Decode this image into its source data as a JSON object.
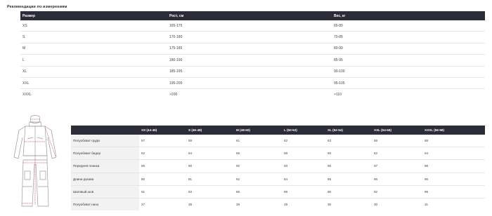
{
  "title": "Рекомендации по измерениям",
  "size_table": {
    "headers": [
      "Размер",
      "Рост, см",
      "Вес, кг"
    ],
    "rows": [
      [
        "XS",
        "165-175",
        "65-80"
      ],
      [
        "S",
        "170-180",
        "70-85"
      ],
      [
        "M",
        "175-185",
        "80-90"
      ],
      [
        "L",
        "180-190",
        "85-95"
      ],
      [
        "XL",
        "185-195",
        "90-100"
      ],
      [
        "XXL",
        "195-205",
        "95-105"
      ],
      [
        "XXXL",
        ">200",
        ">110"
      ]
    ]
  },
  "illustration": {
    "icon": "ski-suit-measurement-diagram-icon"
  },
  "measure_table": {
    "headers": [
      "",
      "XS (44-46)",
      "S (46-48)",
      "M (48-50)",
      "L (50-52)",
      "XL (52-54)",
      "XXL (54-56)",
      "XXXL (56-58)"
    ],
    "rows": [
      [
        "Полуобхват груди",
        "57",
        "59",
        "61",
        "62",
        "63",
        "66",
        "68"
      ],
      [
        "Полуобхват бедер",
        "52",
        "54",
        "56",
        "58",
        "60",
        "62",
        "64"
      ],
      [
        "Передняя планка",
        "86",
        "90",
        "92",
        "93",
        "96",
        "97",
        "98"
      ],
      [
        "Длина рукава",
        "80",
        "81",
        "82",
        "84",
        "85",
        "86",
        "86"
      ],
      [
        "Шаговый шов",
        "81",
        "83",
        "86",
        "89",
        "90",
        "92",
        "96"
      ],
      [
        "Полуобхват низа",
        "27",
        "28",
        "28",
        "29",
        "30",
        "30",
        "31"
      ]
    ]
  }
}
